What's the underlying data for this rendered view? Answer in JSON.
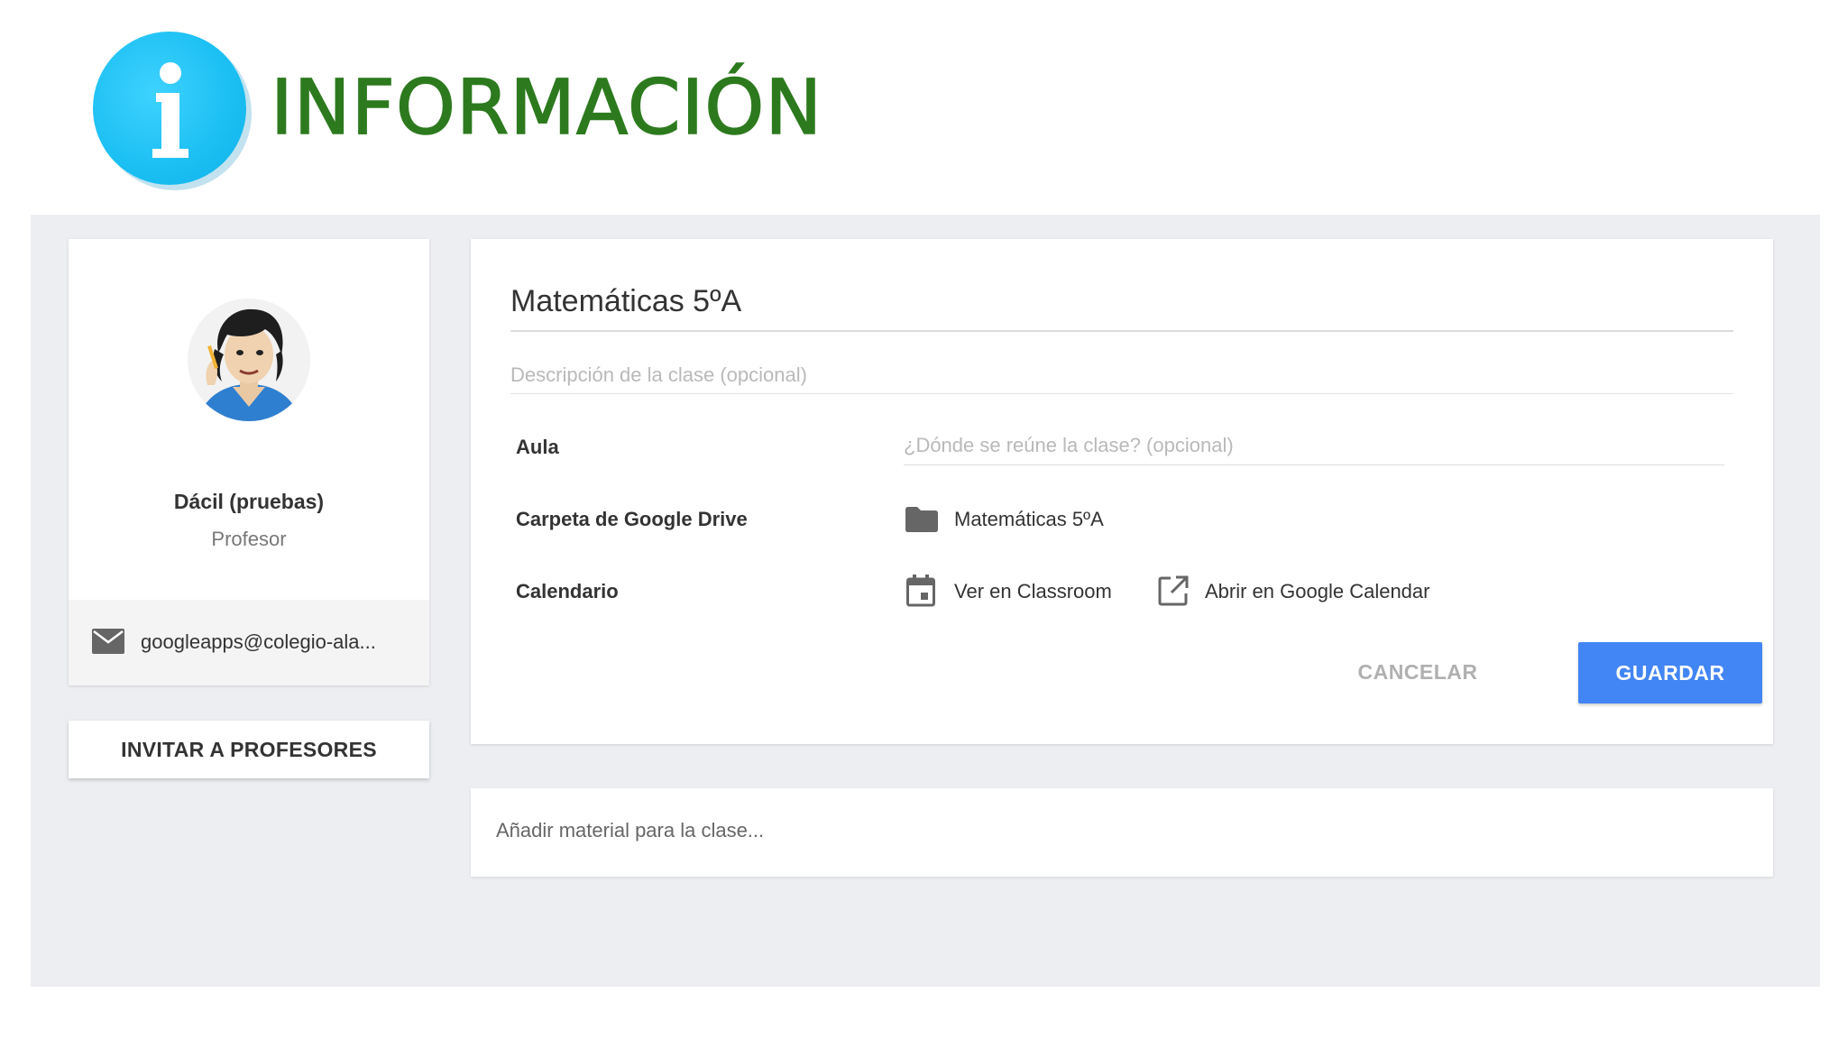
{
  "header": {
    "title": "INFORMACIÓN",
    "icon": "info-icon",
    "icon_color": "#1bbff2",
    "title_color": "#2d7a1e"
  },
  "teacher": {
    "name": "Dácil (pruebas)",
    "role": "Profesor",
    "email": "googleapps@colegio-ala..."
  },
  "invite": {
    "label": "INVITAR A PROFESORES"
  },
  "class_form": {
    "title": "Matemáticas 5ºA",
    "description_placeholder": "Descripción de la clase (opcional)",
    "room_label": "Aula",
    "room_placeholder": "¿Dónde se reúne la clase? (opcional)",
    "drive_label": "Carpeta de Google Drive",
    "drive_folder": "Matemáticas 5ºA",
    "calendar_label": "Calendario",
    "calendar_view_link": "Ver en Classroom",
    "calendar_open_link": "Abrir en Google Calendar",
    "cancel_label": "CANCELAR",
    "save_label": "GUARDAR",
    "accent_color": "#4285f4"
  },
  "material": {
    "placeholder": "Añadir material para la clase..."
  }
}
